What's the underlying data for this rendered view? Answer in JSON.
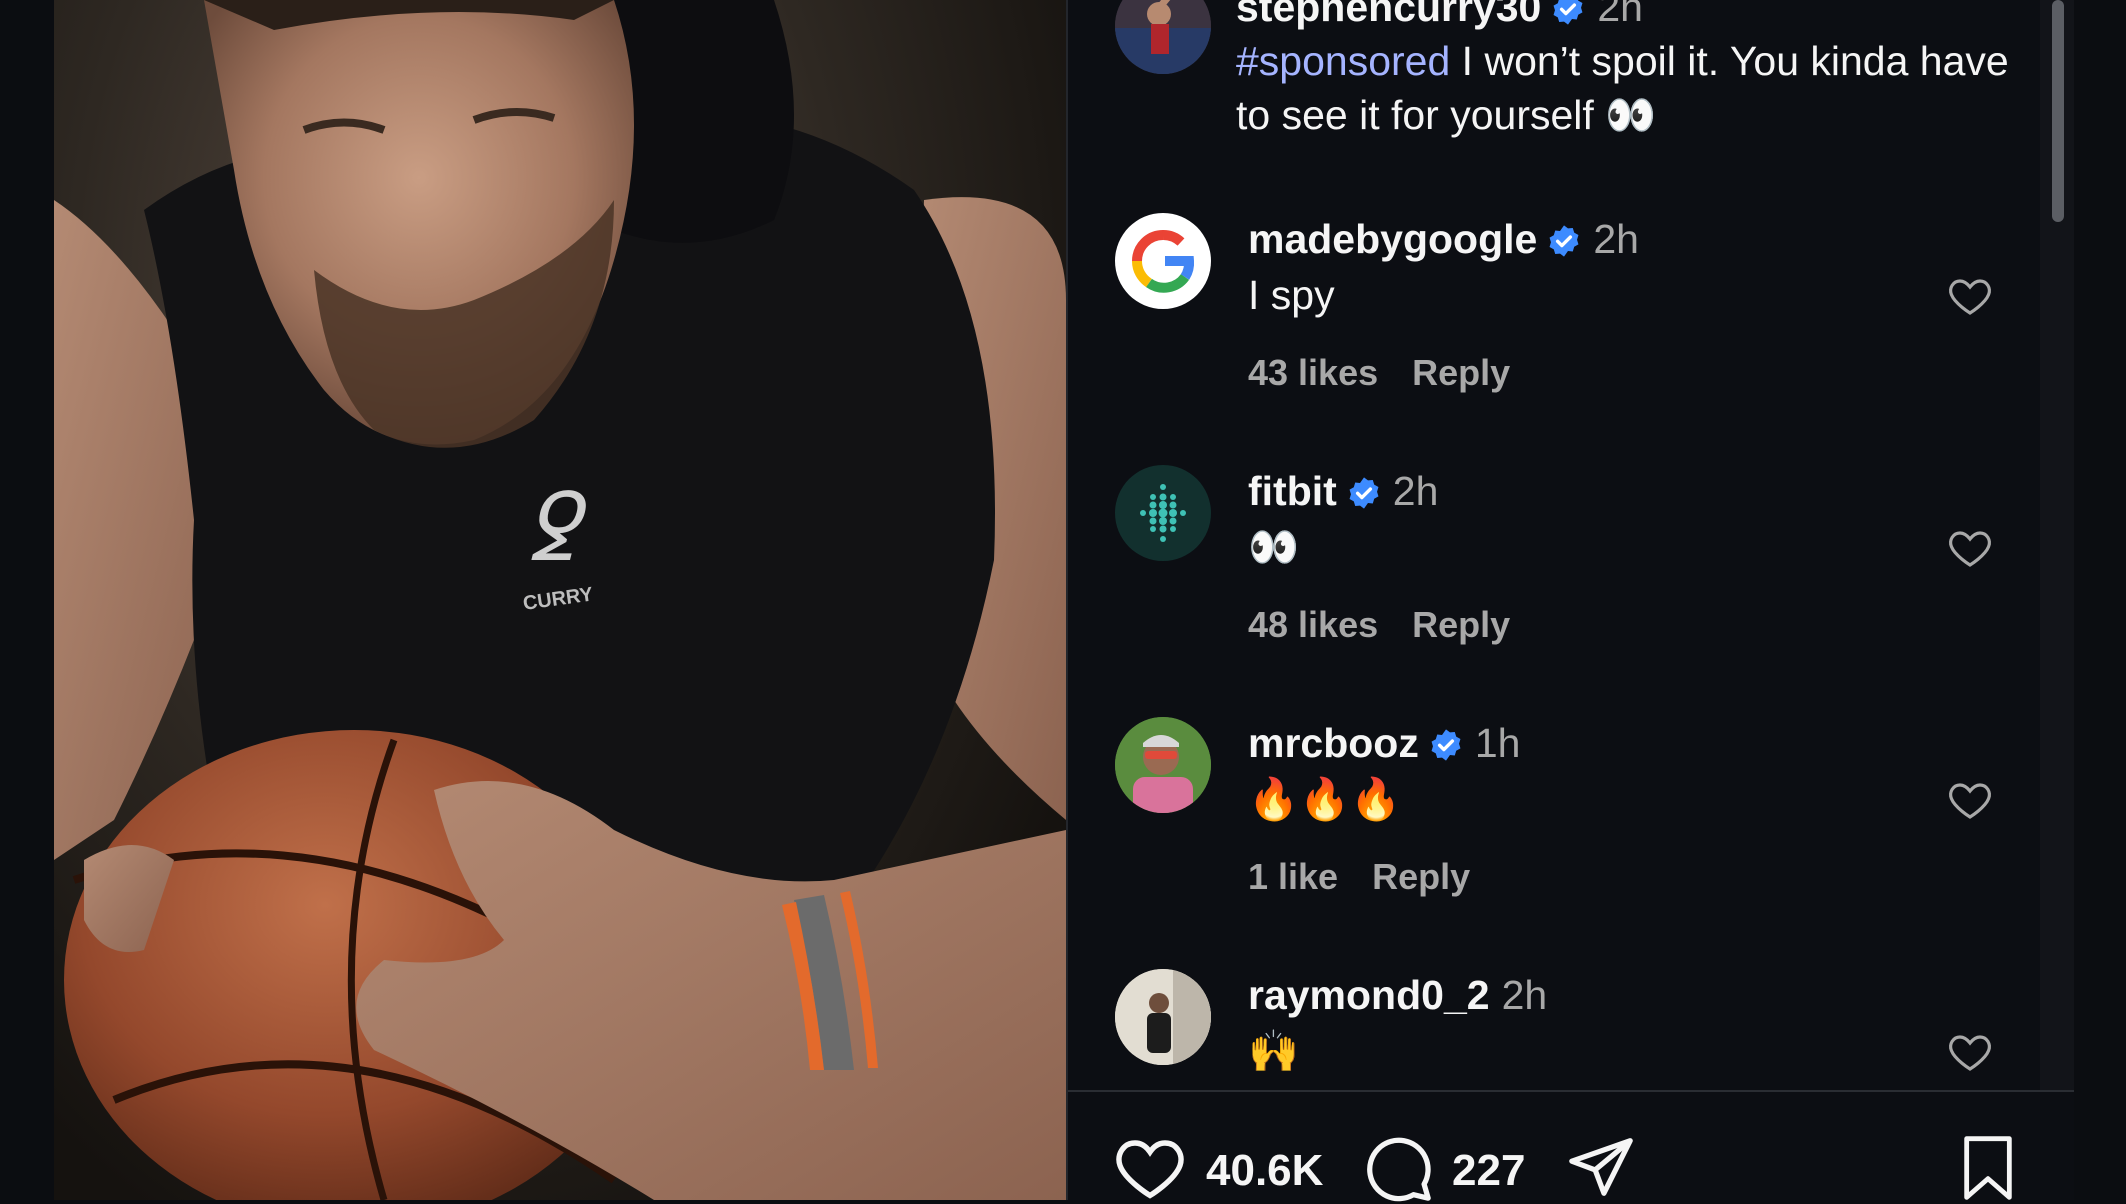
{
  "post": {
    "author": "stephencurry30",
    "time": "2h",
    "caption_hashtag": "#sponsored",
    "caption_text": " I won’t spoil it. You kinda have to see it for yourself 👀",
    "image_text": "CURRY"
  },
  "comments": [
    {
      "user": "madebygoogle",
      "verified": true,
      "time": "2h",
      "text": "I spy",
      "likes": "43 likes",
      "reply": "Reply"
    },
    {
      "user": "fitbit",
      "verified": true,
      "time": "2h",
      "text": "👀",
      "likes": "48 likes",
      "reply": "Reply"
    },
    {
      "user": "mrcbooz",
      "verified": true,
      "time": "1h",
      "text": "🔥🔥🔥",
      "likes": "1 like",
      "reply": "Reply"
    },
    {
      "user": "raymond0_2",
      "verified": false,
      "time": "2h",
      "text": "🙌"
    }
  ],
  "actions": {
    "likes_count": "40.6K",
    "comments_count": "227"
  },
  "colors": {
    "background": "#0c0e13",
    "verified_blue": "#3d8bff",
    "hashtag": "#a5b4ff",
    "muted_text": "#a8a8a8"
  },
  "icons": [
    "verified-badge-icon",
    "heart-icon",
    "comment-icon",
    "share-icon",
    "bookmark-icon"
  ]
}
